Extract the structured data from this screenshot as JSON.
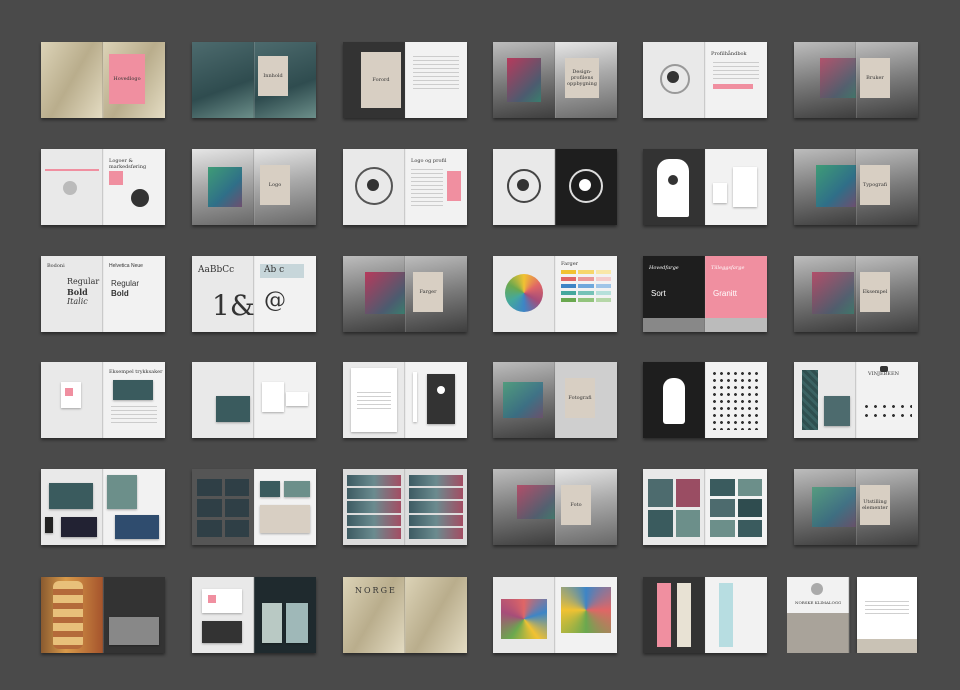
{
  "spreads": [
    {
      "left_title": "",
      "right_title": "Hovedlogo"
    },
    {
      "left_title": "",
      "right_title": "Innhold"
    },
    {
      "left_title": "",
      "right_title": "Forord"
    },
    {
      "left_title": "",
      "right_title": "Design-profilens oppbygning"
    },
    {
      "left_title": "",
      "right_title": "Profilhåndbok"
    },
    {
      "left_title": "",
      "right_title": "Bruker"
    },
    {
      "left_title": "",
      "right_title": "Logoer & markedsføring"
    },
    {
      "left_title": "",
      "right_title": "Logo"
    },
    {
      "left_title": "",
      "right_title": "Logo og profil"
    },
    {
      "left_title": "",
      "right_title": ""
    },
    {
      "left_title": "",
      "right_title": ""
    },
    {
      "left_title": "",
      "right_title": "Typografi"
    },
    {
      "left_title": "Bodoni",
      "right_title": "Helvetica Neue"
    },
    {
      "left_title": "AaBbCc",
      "right_title": "Ab c"
    },
    {
      "left_title": "",
      "right_title": "Farger"
    },
    {
      "left_title": "",
      "right_title": "Farger"
    },
    {
      "left_title": "Hovedfarge",
      "right_title": "Tilleggsfarge"
    },
    {
      "left_title": "",
      "right_title": "Eksempel"
    },
    {
      "left_title": "",
      "right_title": "Eksempel trykksaker"
    },
    {
      "left_title": "",
      "right_title": ""
    },
    {
      "left_title": "",
      "right_title": ""
    },
    {
      "left_title": "",
      "right_title": "Fotografi"
    },
    {
      "left_title": "",
      "right_title": ""
    },
    {
      "left_title": "",
      "right_title": "VINJEBEEN"
    },
    {
      "left_title": "",
      "right_title": ""
    },
    {
      "left_title": "",
      "right_title": ""
    },
    {
      "left_title": "",
      "right_title": ""
    },
    {
      "left_title": "",
      "right_title": "Foto"
    },
    {
      "left_title": "",
      "right_title": ""
    },
    {
      "left_title": "",
      "right_title": "Utstilling elementer"
    },
    {
      "left_title": "",
      "right_title": ""
    },
    {
      "left_title": "",
      "right_title": ""
    },
    {
      "left_title": "NORGE",
      "right_title": ""
    },
    {
      "left_title": "",
      "right_title": ""
    },
    {
      "left_title": "",
      "right_title": ""
    },
    {
      "left_title": "",
      "right_title": ""
    }
  ],
  "type_specimen": {
    "regular": "Regular",
    "bold": "Bold",
    "italic": "Italic",
    "alt_regular": "Regular",
    "alt_bold": "Bold",
    "ampersand": "1&",
    "at": "@"
  },
  "colors": {
    "sort": "Sort",
    "granitt": "Granitt"
  },
  "brochure": {
    "title": "NORSKE KLIMALOGG"
  },
  "palette": {
    "background": "#4a4a4a",
    "pink": "#f08fa0",
    "beige": "#d8cfc3"
  }
}
